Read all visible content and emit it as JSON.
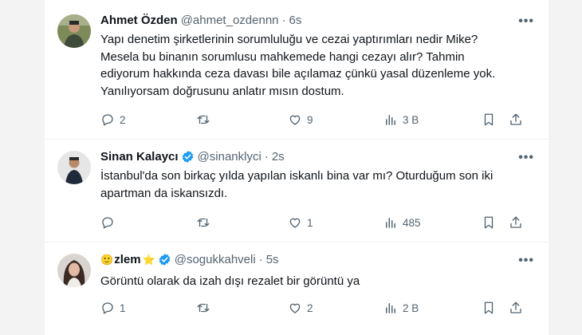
{
  "tweets": [
    {
      "name": "Ahmet Özden",
      "handle": "@ahmet_ozdennn",
      "separator": "·",
      "time": "6s",
      "verified": false,
      "emoji_prefix": "",
      "emoji_suffix": "",
      "text_lines": [
        "Yapı denetim şirketlerinin sorumluluğu ve cezai yaptırımları nedir Mike?",
        "Mesela bu binanın sorumlusu mahkemede hangi cezayı alır? Tahmin",
        "ediyorum hakkında ceza davası bile açılamaz çünkü yasal düzenleme yok.",
        "Yanılıyorsam doğrusunu anlatır mısın dostum."
      ],
      "replies": "2",
      "retweets": "",
      "likes": "9",
      "views": "3 B"
    },
    {
      "name": "Sinan Kalaycı",
      "handle": "@sinanklyci",
      "separator": "·",
      "time": "2s",
      "verified": true,
      "emoji_prefix": "",
      "emoji_suffix": "",
      "text_lines": [
        "İstanbul'da son birkaç yılda yapılan iskanlı bina var mı? Oturduğum son iki",
        "apartman da iskansızdı."
      ],
      "replies": "",
      "retweets": "",
      "likes": "1",
      "views": "485"
    },
    {
      "name": "zlem",
      "handle": "@sogukkahveli",
      "separator": "·",
      "time": "5s",
      "verified": true,
      "emoji_prefix": "🙂",
      "emoji_suffix": "⭐",
      "text_lines": [
        "Görüntü olarak da izah dışı rezalet bir görüntü ya"
      ],
      "replies": "1",
      "retweets": "",
      "likes": "2",
      "views": "2 B"
    }
  ],
  "icons": {
    "reply": "reply-icon",
    "retweet": "retweet-icon",
    "like": "heart-icon",
    "views": "views-icon",
    "bookmark": "bookmark-icon",
    "share": "share-icon",
    "more": "more-icon",
    "verified": "verified-badge-icon"
  },
  "colors": {
    "text": "#0f1419",
    "muted": "#536471",
    "verified": "#1d9bf0",
    "star": "#f4b400"
  },
  "more_glyph": "•••"
}
